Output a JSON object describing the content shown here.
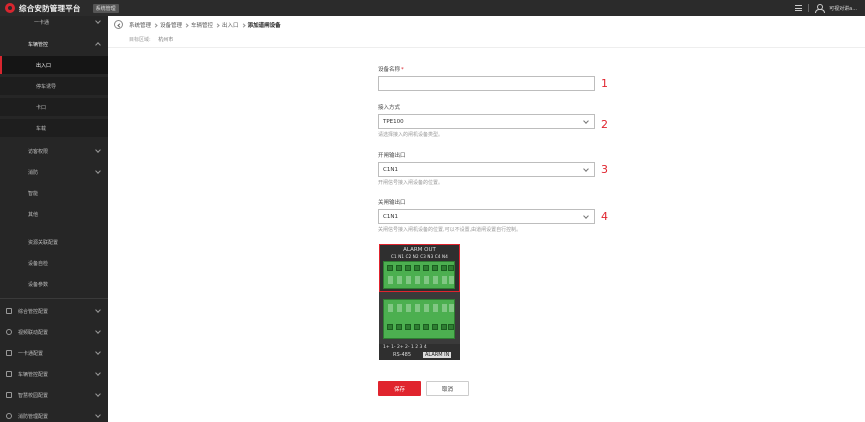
{
  "topbar": {
    "app_title": "综合安防管理平台",
    "system_button": "系统管理",
    "user_name": "可视对讲a..."
  },
  "sidebar": {
    "items": [
      {
        "label": "一卡通",
        "type": "group",
        "expanded": false
      },
      {
        "label": "车辆管控",
        "type": "group",
        "expanded": true
      },
      {
        "label": "出入口",
        "type": "sub",
        "active": true
      },
      {
        "label": "停车诱导",
        "type": "sub"
      },
      {
        "label": "卡口",
        "type": "sub"
      },
      {
        "label": "车载",
        "type": "sub"
      },
      {
        "label": "访客权限",
        "type": "group",
        "expanded": false
      },
      {
        "label": "消防",
        "type": "group",
        "expanded": false
      },
      {
        "label": "智能",
        "type": "plain"
      },
      {
        "label": "其他",
        "type": "plain"
      },
      {
        "label": "资源关联配置",
        "type": "plain"
      },
      {
        "label": "设备自检",
        "type": "plain"
      },
      {
        "label": "设备参数",
        "type": "plain"
      },
      {
        "label": "综合管控配置",
        "type": "section"
      },
      {
        "label": "视频联动配置",
        "type": "section"
      },
      {
        "label": "一卡通配置",
        "type": "section"
      },
      {
        "label": "车辆管控配置",
        "type": "section"
      },
      {
        "label": "智慧校园配置",
        "type": "section"
      },
      {
        "label": "消防管理配置",
        "type": "section"
      }
    ]
  },
  "breadcrumb": {
    "items": [
      "系统管理",
      "设备管理",
      "车辆管控",
      "出入口"
    ],
    "current": "添加道闸设备"
  },
  "area": {
    "label": "目标区域:",
    "value": "杭州市"
  },
  "form": {
    "device_name": {
      "label": "设备名称",
      "required_mark": "*",
      "value": ""
    },
    "access_mode": {
      "label": "接入方式",
      "value": "TPE100",
      "hint": "请选择接入的闸机设备类型。"
    },
    "open_output": {
      "label": "开闸输出口",
      "value": "C1N1",
      "hint": "开闸信号接入闸设备的位置。"
    },
    "close_output": {
      "label": "关闸输出口",
      "value": "C1N1",
      "hint": "关闸信号接入闸机设备的位置,可以不设置,由道闸设置自行控制。"
    }
  },
  "annotations": [
    "1",
    "2",
    "3",
    "4"
  ],
  "terminal_image": {
    "top_label": "ALARM OUT",
    "top_pins": "C1 N1 C2 N2 C3 N3 C4 N4",
    "bottom_pins": "1+ 1- 2+ 2-  1 2 3 4",
    "bottom_left_label": "RS-485",
    "bottom_right_label": "ALARM IN"
  },
  "buttons": {
    "save": "保存",
    "cancel": "取消"
  },
  "colors": {
    "accent": "#e0242e",
    "topbar_bg": "#2b2b2b",
    "sidebar_bg": "#262626"
  }
}
